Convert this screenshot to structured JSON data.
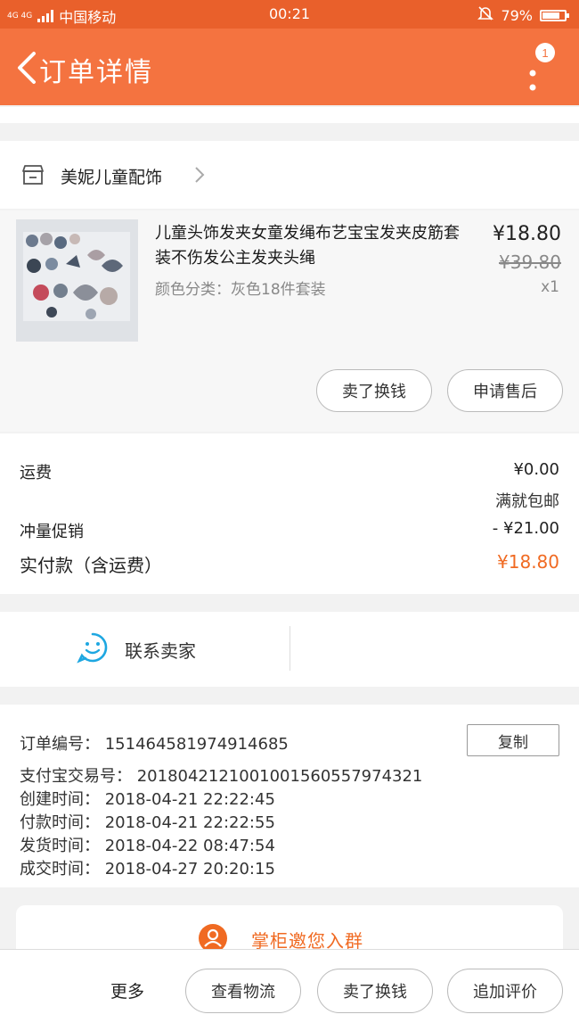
{
  "status_bar": {
    "network": "4G 4G",
    "carrier": "中国移动",
    "time": "00:21",
    "battery": "79%",
    "battery_level": 0.79
  },
  "header": {
    "title": "订单详情",
    "notification_count": "1"
  },
  "shop": {
    "name": "美妮儿童配饰"
  },
  "product": {
    "title": "儿童头饰发夹女童发绳布艺宝宝发夹皮筋套装不伤发公主发夹头绳",
    "spec": "颜色分类：灰色18件套装",
    "price": "¥18.80",
    "original_price": "¥39.80",
    "quantity": "x1",
    "actions": [
      "卖了换钱",
      "申请售后"
    ]
  },
  "fees": {
    "shipping_label": "运费",
    "shipping_value": "¥0.00",
    "shipping_note": "满就包邮",
    "promo_label": "冲量促销",
    "promo_value": "- ¥21.00",
    "paid_label": "实付款（含运费）",
    "paid_value": "¥18.80"
  },
  "contact": {
    "label": "联系卖家"
  },
  "order_info": {
    "order_no": "订单编号：  151464581974914685",
    "copy_label": "复制",
    "alipay_no": "支付宝交易号：  2018042121001001560557974321",
    "created": "创建时间：  2018-04-21 22:22:45",
    "paid": "付款时间：  2018-04-21 22:22:55",
    "shipped": "发货时间：  2018-04-22 08:47:54",
    "completed": "成交时间：  2018-04-27 20:20:15"
  },
  "group_banner": {
    "label": "掌柜邀您入群"
  },
  "bottom_bar": {
    "more": "更多",
    "buttons": [
      "查看物流",
      "卖了换钱",
      "追加评价"
    ]
  },
  "colors": {
    "brand": "#f47340",
    "status": "#e9602b",
    "accent": "#f06a22"
  }
}
